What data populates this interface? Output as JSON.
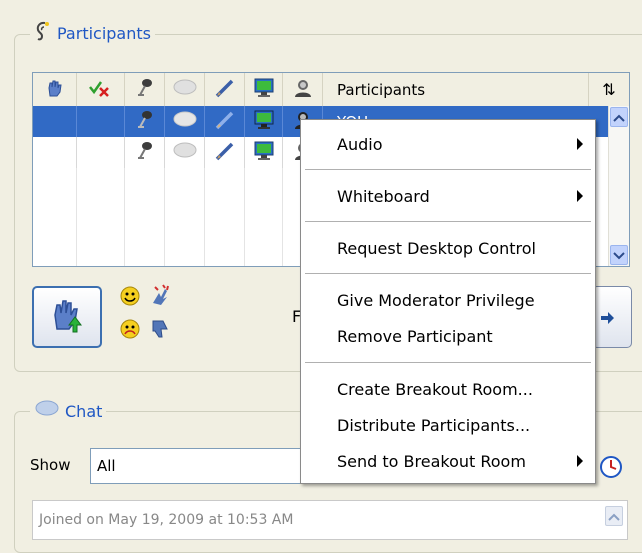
{
  "participants_panel": {
    "title": "Participants",
    "grid": {
      "column_header_label": "Participants",
      "header_icons": [
        "raise-hand-icon",
        "checkmark-x-icon",
        "microphone-icon",
        "speech-bubble-icon",
        "pencil-icon",
        "monitor-icon",
        "user-icon"
      ],
      "rows": [
        {
          "name": "YOU",
          "selected": true
        },
        {
          "name": "",
          "selected": false
        }
      ]
    },
    "side_label": "F"
  },
  "context_menu": {
    "items": [
      {
        "label": "Audio",
        "has_submenu": true
      },
      {
        "label": "Whiteboard",
        "has_submenu": true
      },
      {
        "label": "Request Desktop Control",
        "has_submenu": false
      },
      {
        "label": "Give Moderator Privilege",
        "has_submenu": false
      },
      {
        "label": "Remove Participant",
        "has_submenu": false
      },
      {
        "label": "Create Breakout Room...",
        "has_submenu": false
      },
      {
        "label": "Distribute Participants...",
        "has_submenu": false
      },
      {
        "label": "Send to Breakout Room",
        "has_submenu": true
      }
    ]
  },
  "chat_panel": {
    "title": "Chat",
    "show_label": "Show",
    "show_value": "All",
    "log_text": "Joined on May 19, 2009 at 10:53 AM"
  },
  "colors": {
    "selection": "#316ac5",
    "legend_text": "#1f57c4",
    "panel_bg": "#f1efe2"
  }
}
